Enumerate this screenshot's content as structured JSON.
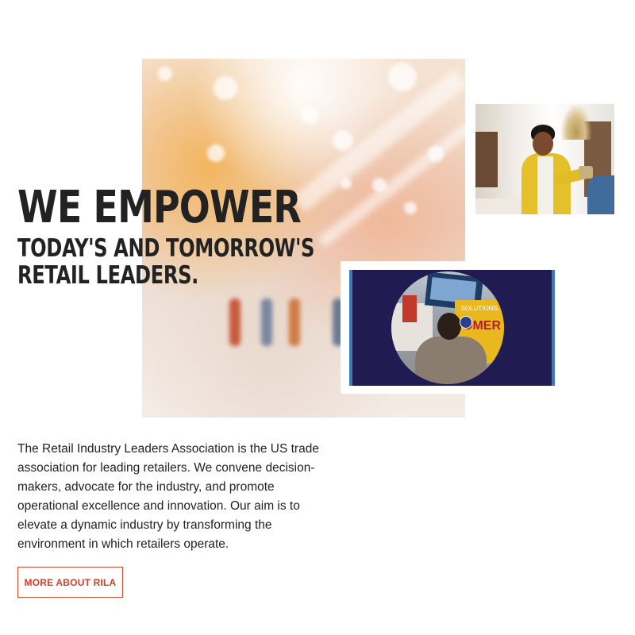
{
  "hero": {
    "headline_main": "WE EMPOWER",
    "headline_line2": "TODAY'S AND TOMORROW'S",
    "headline_line3": "RETAIL LEADERS."
  },
  "video": {
    "sign_text": "OMER",
    "sign_subtext": "SOLUTIONS."
  },
  "about": {
    "description": "The Retail Industry Leaders Association is the US trade association for leading retailers. We convene decision-makers, advocate for the industry, and promote operational excellence and innovation. Our aim is to elevate a dynamic industry by transforming the environment in which retailers operate.",
    "button_label": "MORE ABOUT RILA"
  },
  "colors": {
    "accent": "#d64a2f",
    "video_background": "#201c52",
    "text": "#222222"
  }
}
